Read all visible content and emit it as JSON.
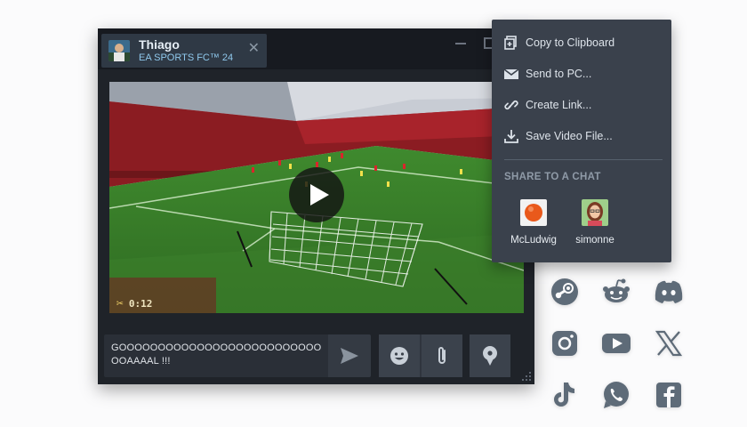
{
  "chat": {
    "friend_name": "Thiago",
    "game": "EA SPORTS FC™ 24",
    "clip_time": "0:12",
    "message": "GOOOOOOOOOOOOOOOOOOOOOOOOOOOOAAAAL !!!"
  },
  "share_menu": {
    "items": [
      {
        "label": "Copy to Clipboard",
        "icon": "clipboard-plus-icon"
      },
      {
        "label": "Send to PC...",
        "icon": "envelope-icon"
      },
      {
        "label": "Create Link...",
        "icon": "link-icon"
      },
      {
        "label": "Save Video File...",
        "icon": "download-icon"
      }
    ],
    "share_heading": "SHARE TO A CHAT",
    "friends": [
      {
        "name": "McLudwig",
        "avatar": "orange-ball-avatar"
      },
      {
        "name": "simonne",
        "avatar": "girl-avatar"
      }
    ]
  },
  "social": [
    "steam-icon",
    "reddit-icon",
    "discord-icon",
    "instagram-icon",
    "youtube-icon",
    "x-icon",
    "tiktok-icon",
    "whatsapp-icon",
    "facebook-icon"
  ],
  "colors": {
    "window_bg": "#1f2329",
    "menu_bg": "#3a414c",
    "accent_blue": "#8fc8ec",
    "social_icon": "#5e6b78"
  }
}
